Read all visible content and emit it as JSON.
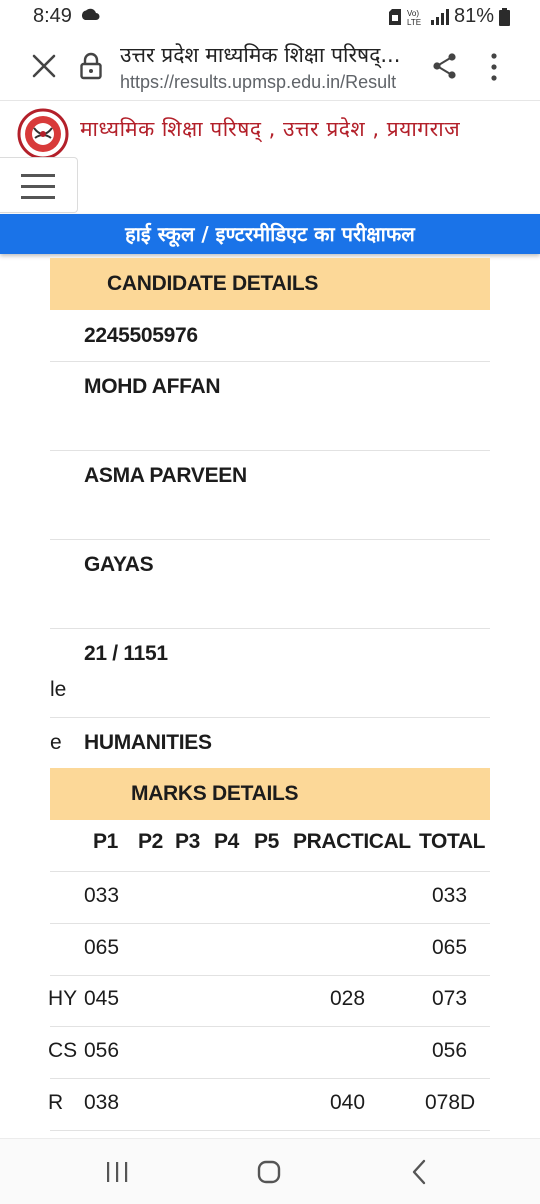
{
  "status": {
    "time": "8:49",
    "network": "VoLTE",
    "battery": "81%"
  },
  "browser": {
    "title": "उत्तर प्रदेश माध्यमिक शिक्षा परिषद्...",
    "url": "https://results.upmsp.edu.in/Result"
  },
  "site": {
    "name": "माध्यमिक शिक्षा परिषद् , उत्तर प्रदेश , प्रयागराज",
    "banner": "हाई स्कूल / इण्टरमीडिएट का परीक्षाफल"
  },
  "candidate": {
    "header": "CANDIDATE DETAILS",
    "roll_no": "2245505976",
    "name": "MOHD AFFAN",
    "mother_name": "ASMA PARVEEN",
    "father_name": "GAYAS",
    "school_code": "21 / 1151",
    "label_fragment_1": "le",
    "label_fragment_2": "e",
    "group": "HUMANITIES"
  },
  "marks": {
    "header": "MARKS DETAILS",
    "columns": [
      "P1",
      "P2",
      "P3",
      "P4",
      "P5",
      "PRACTICAL",
      "TOTAL"
    ],
    "rows": [
      {
        "subject_fragment": "",
        "p1": "033",
        "practical": "",
        "total": "033"
      },
      {
        "subject_fragment": "",
        "p1": "065",
        "practical": "",
        "total": "065"
      },
      {
        "subject_fragment": "HY",
        "p1": "045",
        "practical": "028",
        "total": "073"
      },
      {
        "subject_fragment": "CS",
        "p1": "056",
        "practical": "",
        "total": "056"
      },
      {
        "subject_fragment": "R",
        "p1": "038",
        "practical": "040",
        "total": "078D"
      }
    ]
  },
  "colors": {
    "banner": "#1a73e8",
    "section_header": "#fcd898",
    "site_name": "#b3202a"
  }
}
